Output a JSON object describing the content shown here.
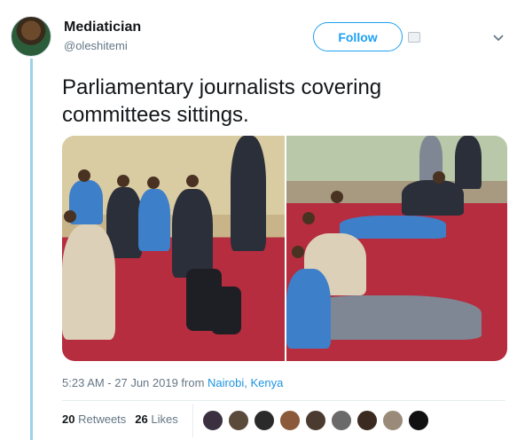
{
  "author": {
    "name": "Mediatician",
    "handle": "@oleshitemi"
  },
  "actions": {
    "follow_label": "Follow"
  },
  "tweet": {
    "text": "Parliamentary journalists covering committees sittings.",
    "timestamp": "5:23 AM - 27 Jun 2019 from ",
    "location": "Nairobi, Kenya"
  },
  "stats": {
    "retweets_count": "20",
    "retweets_label": "Retweets",
    "likes_count": "26",
    "likes_label": "Likes"
  },
  "likers": [
    {
      "icon": "liker-avatar-1",
      "color": "#3b3040"
    },
    {
      "icon": "liker-avatar-2",
      "color": "#5a4a3a"
    },
    {
      "icon": "liker-avatar-3",
      "color": "#2a2a2a"
    },
    {
      "icon": "liker-avatar-4",
      "color": "#8a5a3a"
    },
    {
      "icon": "liker-avatar-5",
      "color": "#4a3a30"
    },
    {
      "icon": "liker-avatar-6",
      "color": "#6a6a6a"
    },
    {
      "icon": "liker-avatar-7",
      "color": "#3a2a20"
    },
    {
      "icon": "liker-avatar-8",
      "color": "#9a8a7a"
    },
    {
      "icon": "liker-avatar-9",
      "color": "#111111"
    }
  ],
  "colors": {
    "accent": "#1da1f2",
    "link": "#1b95e0",
    "thread": "#9fd0e8",
    "carpet": "#b52d3e"
  }
}
